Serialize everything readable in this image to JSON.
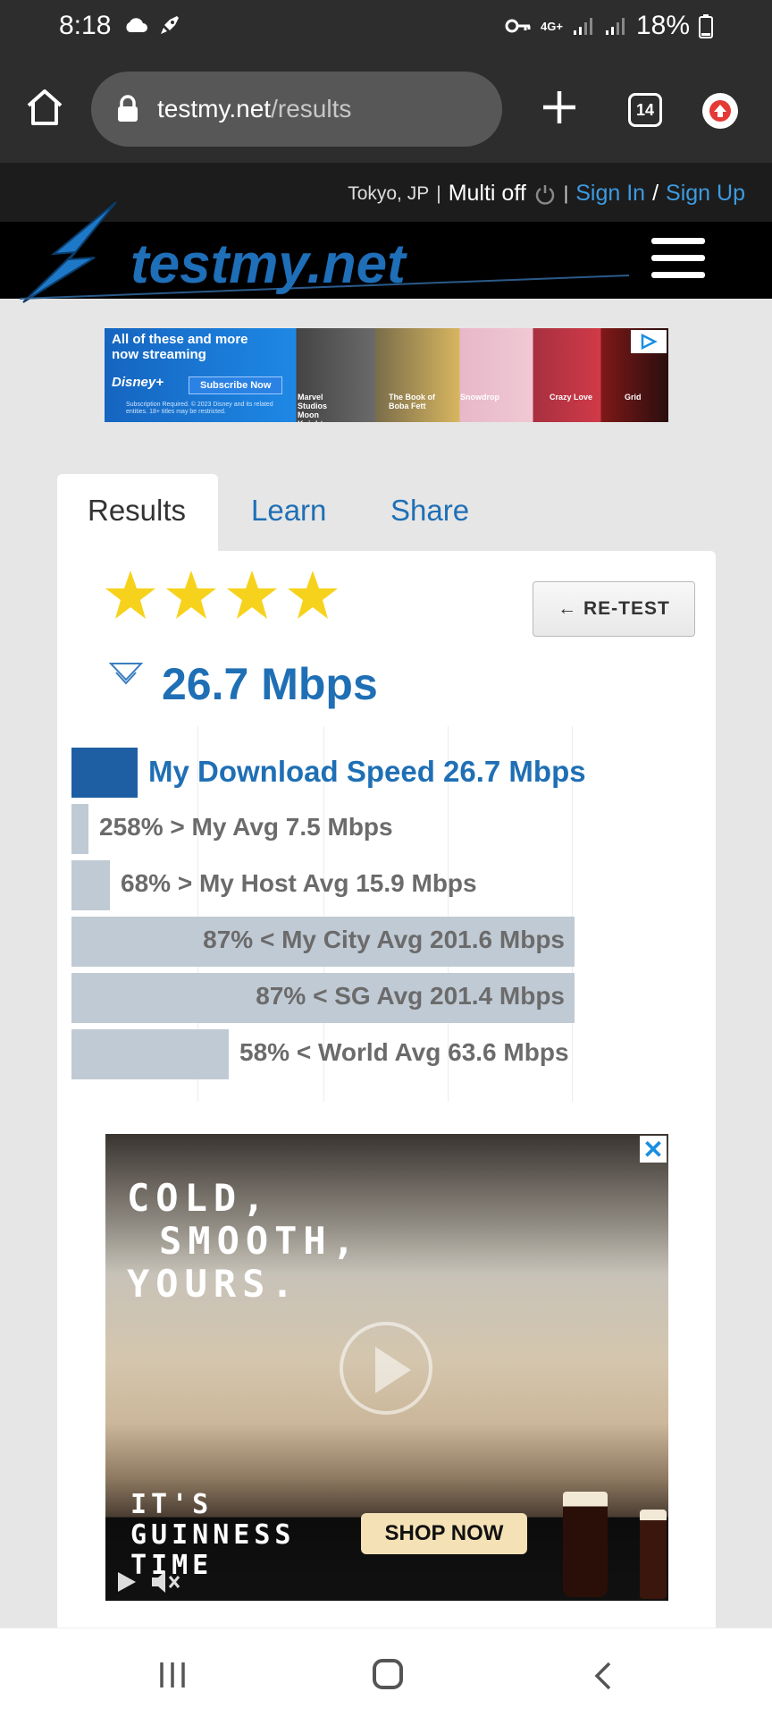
{
  "status_bar": {
    "time": "8:18",
    "network": "4G+",
    "battery": "18%"
  },
  "browser": {
    "url_host": "testmy.net",
    "url_path": "/results",
    "tab_count": "14"
  },
  "site_top": {
    "location": "Tokyo, JP",
    "separator": "|",
    "multi": "Multi off",
    "sign_in": "Sign In",
    "slash": "/",
    "sign_up": "Sign Up"
  },
  "site": {
    "logo_text": "testmy.net"
  },
  "ad_top": {
    "headline_1": "All of these and more",
    "headline_2": "now streaming",
    "brand": "Disney+",
    "cta": "Subscribe Now",
    "small_print": "Subscription Required. © 2023 Disney and its related entities. 18+ titles may be restricted.",
    "captions": [
      "Marvel Studios Moon Knight",
      "The Book of Boba Fett",
      "Snowdrop",
      "Crazy Love",
      "Grid"
    ]
  },
  "tabs": {
    "results": "Results",
    "learn": "Learn",
    "share": "Share"
  },
  "results": {
    "rating_stars": 4,
    "retest_label": "← RE-TEST",
    "headline_speed": "26.7 Mbps"
  },
  "comparison": {
    "rows": [
      {
        "label": "My Download Speed 26.7 Mbps",
        "speed_mbps": 26.7
      },
      {
        "label": "258% > My Avg 7.5 Mbps",
        "speed_mbps": 7.5
      },
      {
        "label": "68% > My Host Avg 15.9 Mbps",
        "speed_mbps": 15.9
      },
      {
        "label": "87% < My City Avg 201.6 Mbps",
        "speed_mbps": 201.6
      },
      {
        "label": "87% < SG Avg 201.4 Mbps",
        "speed_mbps": 201.4
      },
      {
        "label": "58% < World Avg 63.6 Mbps",
        "speed_mbps": 63.6
      }
    ]
  },
  "ad_bottom": {
    "headline": [
      "COLD,",
      "SMOOTH,",
      "YOURS."
    ],
    "tagline": [
      "IT'S",
      "GUINNESS",
      "TIME"
    ],
    "cta": "SHOP NOW",
    "close": "✕"
  },
  "colors": {
    "accent_blue": "#1f6fb5",
    "main_bar": "#1e5fa4",
    "compare_bar": "#c0cad4",
    "star": "#f7d21c"
  }
}
